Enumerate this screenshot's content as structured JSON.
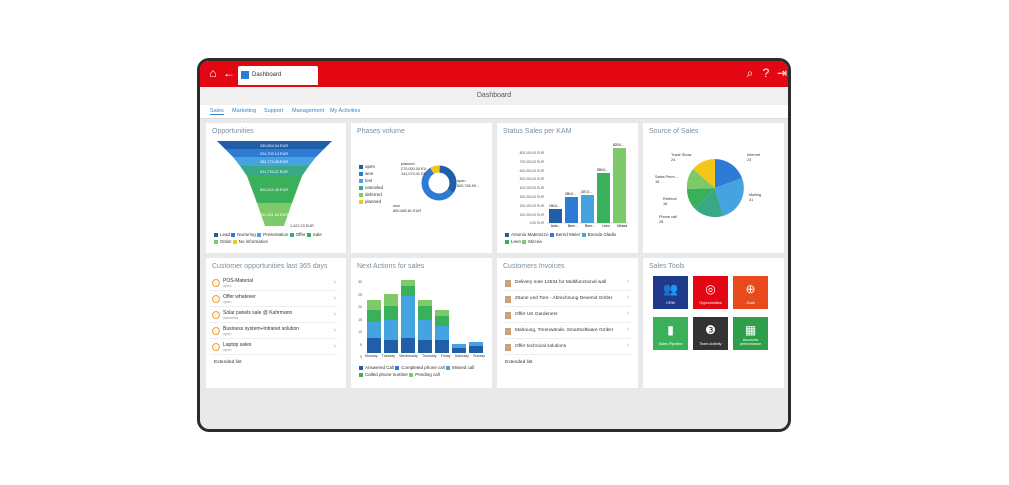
{
  "app": {
    "tab_label": "Dashboard",
    "title": "Dashboard"
  },
  "subnav": [
    "Sales",
    "Marketing",
    "Support",
    "Management",
    "My Activities"
  ],
  "panels": {
    "opportunities": {
      "title": "Opportunities",
      "funnel_labels": [
        "330,804.04 EUR",
        "224,703.14 EUR",
        "254,774.48 EUR",
        "511,776.21 EUR",
        "820,224.45 EUR",
        "332,261.64 EUR",
        "1,422.23 EUR"
      ],
      "legend": [
        "Lead",
        "Nurturing",
        "Presentation",
        "Offer",
        "Sale",
        "Order",
        "No information"
      ]
    },
    "phases": {
      "title": "Phases volume",
      "legend": [
        "open",
        "won",
        "lost",
        "canceled",
        "deferred",
        "planned"
      ],
      "callouts": [
        "planned",
        "270,000.00 EU",
        "141,074.41 EU",
        "open",
        "800,765.59...",
        "won",
        "850,680.81 EUR"
      ]
    },
    "status": {
      "title": "Status Sales per KAM",
      "yticks": [
        "800,000.00 EUR",
        "700,000.00 EUR",
        "600,000.00 EUR",
        "500,000.00 EUR",
        "400,000.00 EUR",
        "300,000.00 EUR",
        "200,000.00 EUR",
        "100,000.00 EUR",
        "0.00 EUR"
      ],
      "bar_labels": [
        "150,0...",
        "280,0...",
        "307,0...",
        "550,0...",
        "820,0..."
      ],
      "categories": [
        "Anto...",
        "Bern...",
        "Bren...",
        "Leen",
        "Mircea"
      ],
      "legend": [
        "Antonio Materazzo",
        "Bernd Meier",
        "Brenda Gladis",
        "Leen",
        "Mircea"
      ]
    },
    "source": {
      "title": "Source of Sales",
      "labels": [
        "Trade Show",
        "24",
        "Internet",
        "23",
        "Sales Perm...",
        "16",
        "Mailing",
        "41",
        "Referral",
        "18",
        "Phone call",
        "28"
      ]
    },
    "customer_opps": {
      "title": "Customer opportunities last 365 days",
      "items": [
        {
          "title": "POS-Material",
          "status": "open"
        },
        {
          "title": "Offer whatever",
          "status": "open"
        },
        {
          "title": "Solar panels sale @ Kahrmann",
          "status": "canceled"
        },
        {
          "title": "Business system+Intranet solution",
          "status": "open"
        },
        {
          "title": "Laptop sales",
          "status": "open"
        }
      ],
      "extended": "Extended list"
    },
    "next_actions": {
      "title": "Next Actions for sales",
      "yticks": [
        "30",
        "25",
        "20",
        "15",
        "10",
        "5",
        "0"
      ],
      "days": [
        "Monday",
        "Tuesday",
        "Wednesday",
        "Thursday",
        "Friday",
        "Saturday",
        "Sunday"
      ],
      "legend": [
        "Answered Call",
        "Completed phone call",
        "Missed call",
        "Called phone number",
        "Pending call"
      ]
    },
    "invoices": {
      "title": "Customers Invoices",
      "items": [
        "Delivery note 12534 for Multifunctional wall",
        "Zäune und Tore - Abrechnung Devemit GmbH",
        "Offer UK Gardeners",
        "Mahnung, Trennwände, Smartsoftware GmbH",
        "Offer technical solutions"
      ],
      "extended": "Extended list"
    },
    "tools": {
      "title": "Sales Tools",
      "tiles": [
        "CRM",
        "Opportunities",
        "Goal",
        "Sales Pipeline",
        "Team Activity",
        "Accounts performance"
      ]
    }
  },
  "colors": {
    "brand": "#e30613",
    "blue": "#2e7bd6",
    "green": "#3aa655"
  }
}
